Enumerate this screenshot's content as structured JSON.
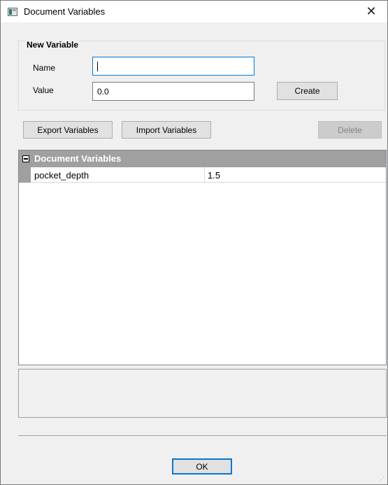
{
  "window": {
    "title": "Document Variables"
  },
  "new_variable": {
    "group_title": "New Variable",
    "name_label": "Name",
    "name_value": "",
    "value_label": "Value",
    "value_value": "0.0",
    "create_label": "Create"
  },
  "toolbar": {
    "export_label": "Export Variables",
    "import_label": "Import Variables",
    "delete_label": "Delete"
  },
  "variables": {
    "category": "Document Variables",
    "rows": [
      {
        "name": "pocket_depth",
        "value": "1.5"
      }
    ]
  },
  "footer": {
    "ok_label": "OK"
  },
  "colors": {
    "accent": "#0078d7",
    "category_bg": "#a0a0a0"
  }
}
